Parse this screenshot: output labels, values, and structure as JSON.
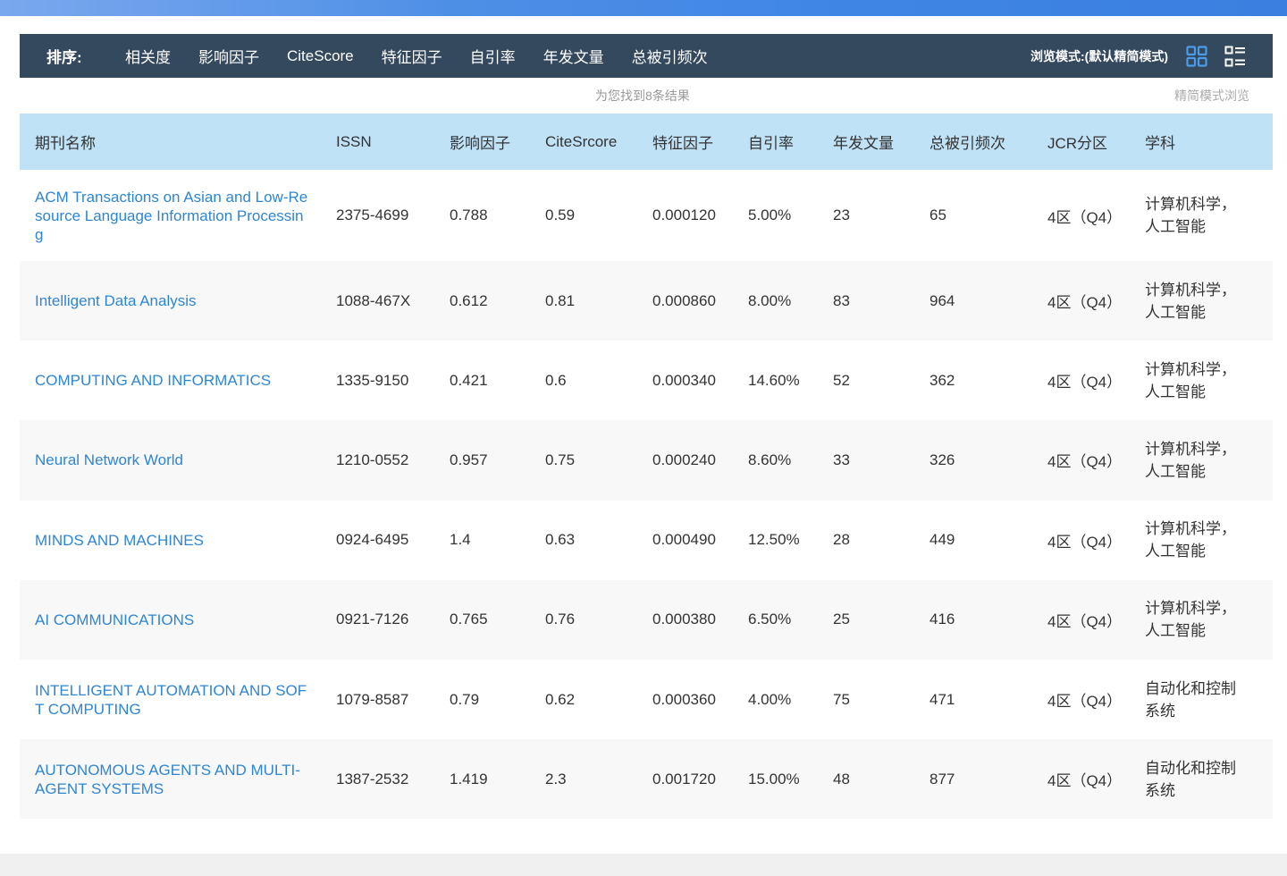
{
  "toolbar": {
    "sort_label": "排序:",
    "sort_options": [
      "相关度",
      "影响因子",
      "CiteScore",
      "特征因子",
      "自引率",
      "年发文量",
      "总被引频次"
    ],
    "browse_mode": "浏览模式:(默认精简模式)"
  },
  "results": {
    "count_text": "为您找到8条结果",
    "simple_mode_link": "精简模式浏览"
  },
  "table": {
    "headers": [
      "期刊名称",
      "ISSN",
      "影响因子",
      "CiteSrcore",
      "特征因子",
      "自引率",
      "年发文量",
      "总被引频次",
      "JCR分区",
      "学科"
    ],
    "rows": [
      {
        "name": "ACM Transactions on Asian and Low-Resource Language Information Processing",
        "issn": "2375-4699",
        "impact": "0.788",
        "citescore": "0.59",
        "eigen": "0.000120",
        "self_cite": "5.00%",
        "annual": "23",
        "total_cites": "65",
        "jcr": "4区（Q4）",
        "subject": "计算机科学，人工智能"
      },
      {
        "name": "Intelligent Data Analysis",
        "issn": "1088-467X",
        "impact": "0.612",
        "citescore": "0.81",
        "eigen": "0.000860",
        "self_cite": "8.00%",
        "annual": "83",
        "total_cites": "964",
        "jcr": "4区（Q4）",
        "subject": "计算机科学，人工智能"
      },
      {
        "name": "COMPUTING AND INFORMATICS",
        "issn": "1335-9150",
        "impact": "0.421",
        "citescore": "0.6",
        "eigen": "0.000340",
        "self_cite": "14.60%",
        "annual": "52",
        "total_cites": "362",
        "jcr": "4区（Q4）",
        "subject": "计算机科学，人工智能"
      },
      {
        "name": "Neural Network World",
        "issn": "1210-0552",
        "impact": "0.957",
        "citescore": "0.75",
        "eigen": "0.000240",
        "self_cite": "8.60%",
        "annual": "33",
        "total_cites": "326",
        "jcr": "4区（Q4）",
        "subject": "计算机科学，人工智能"
      },
      {
        "name": "MINDS AND MACHINES",
        "issn": "0924-6495",
        "impact": "1.4",
        "citescore": "0.63",
        "eigen": "0.000490",
        "self_cite": "12.50%",
        "annual": "28",
        "total_cites": "449",
        "jcr": "4区（Q4）",
        "subject": "计算机科学，人工智能"
      },
      {
        "name": "AI COMMUNICATIONS",
        "issn": "0921-7126",
        "impact": "0.765",
        "citescore": "0.76",
        "eigen": "0.000380",
        "self_cite": "6.50%",
        "annual": "25",
        "total_cites": "416",
        "jcr": "4区（Q4）",
        "subject": "计算机科学，人工智能"
      },
      {
        "name": "INTELLIGENT AUTOMATION AND SOFT COMPUTING",
        "issn": "1079-8587",
        "impact": "0.79",
        "citescore": "0.62",
        "eigen": "0.000360",
        "self_cite": "4.00%",
        "annual": "75",
        "total_cites": "471",
        "jcr": "4区（Q4）",
        "subject": "自动化和控制系统"
      },
      {
        "name": "AUTONOMOUS AGENTS AND MULTI-AGENT SYSTEMS",
        "issn": "1387-2532",
        "impact": "1.419",
        "citescore": "2.3",
        "eigen": "0.001720",
        "self_cite": "15.00%",
        "annual": "48",
        "total_cites": "877",
        "jcr": "4区（Q4）",
        "subject": "自动化和控制系统"
      }
    ]
  },
  "icons": {
    "grid_view": "grid-view-icon",
    "list_view": "list-view-icon"
  },
  "colors": {
    "toolbar_bg": "#34485e",
    "header_bg": "#bfe2f7",
    "link": "#2f86d0"
  }
}
